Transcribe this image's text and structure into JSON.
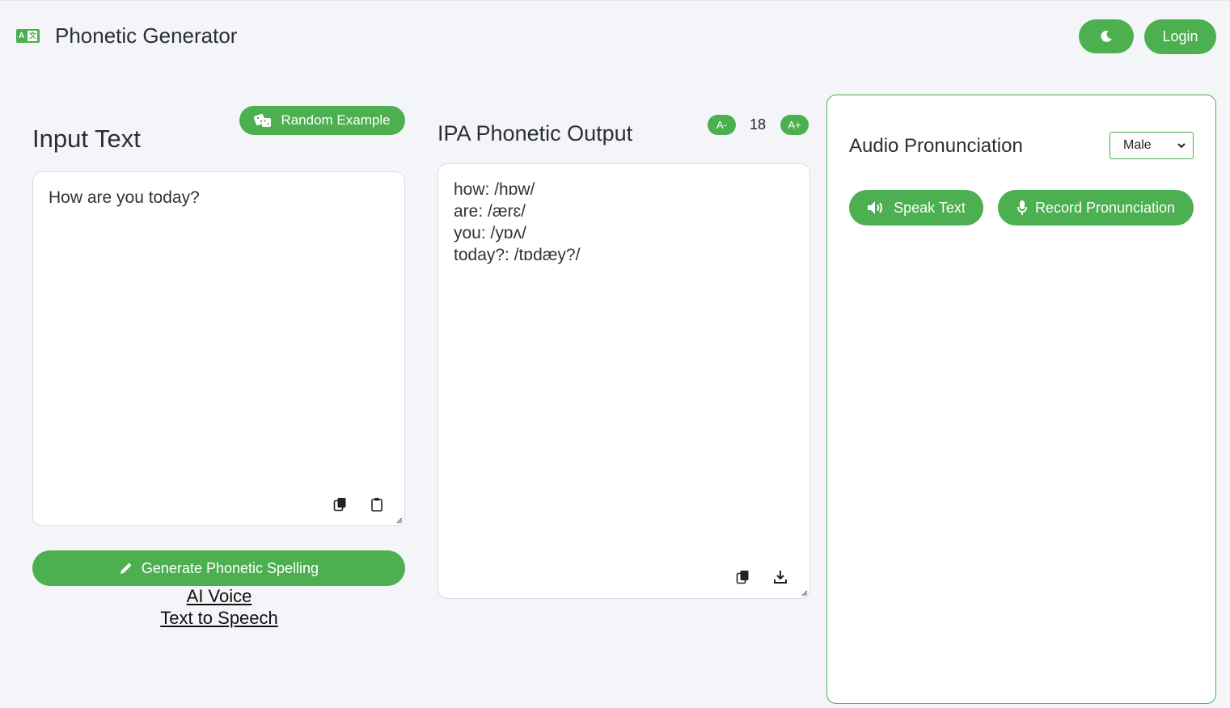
{
  "header": {
    "brand_badge_left": "A",
    "brand_badge_right": "文",
    "title": "Phonetic Generator",
    "login_label": "Login"
  },
  "input": {
    "title": "Input Text",
    "random_label": "Random Example",
    "text": "How are you today?",
    "generate_label": "Generate Phonetic Spelling"
  },
  "links": {
    "ai_voice": "AI Voice",
    "tts": "Text to Speech"
  },
  "output": {
    "title": "IPA Phonetic Output",
    "font_dec_label": "A-",
    "font_size": "18",
    "font_inc_label": "A+",
    "text": "how: /hɒw/\nare: /ærɛ/\nyou: /yɒʌ/\ntoday?: /tɒdæy?/"
  },
  "audio": {
    "title": "Audio Pronunciation",
    "voice_selected": "Male",
    "speak_label": "Speak Text",
    "record_label": "Record Pronunciation"
  },
  "colors": {
    "accent": "#4caf50",
    "background": "#f4f5f8"
  },
  "icons": [
    "language-icon",
    "moon-icon",
    "dice-icon",
    "copy-icon",
    "paste-icon",
    "download-icon",
    "pencil-icon",
    "speaker-icon",
    "microphone-icon",
    "chevron-down-icon"
  ]
}
